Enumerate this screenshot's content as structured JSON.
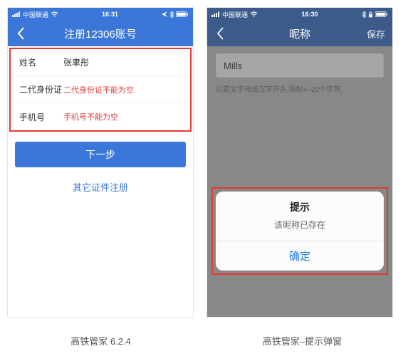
{
  "left": {
    "status": {
      "carrier": "中国联通",
      "time": "16:31",
      "battery": null
    },
    "nav": {
      "title": "注册12306账号"
    },
    "rows": {
      "name_label": "姓名",
      "name_value": "张聿彤",
      "id_label": "二代身份证",
      "id_error": "二代身份证不能为空",
      "phone_label": "手机号",
      "phone_error": "手机号不能为空"
    },
    "next_btn": "下一步",
    "alt_link": "其它证件注册",
    "caption": "高铁管家 6.2.4"
  },
  "right": {
    "status": {
      "carrier": "中国联通",
      "time": "16:30"
    },
    "nav": {
      "title": "昵称",
      "save": "保存"
    },
    "nick_value": "Mills",
    "nick_hint": "以英文字母或汉字开头,限制4~20个字符,",
    "dialog": {
      "title": "提示",
      "message": "该昵称已存在",
      "confirm": "确定"
    },
    "caption": "高铁管家–提示弹窗"
  }
}
